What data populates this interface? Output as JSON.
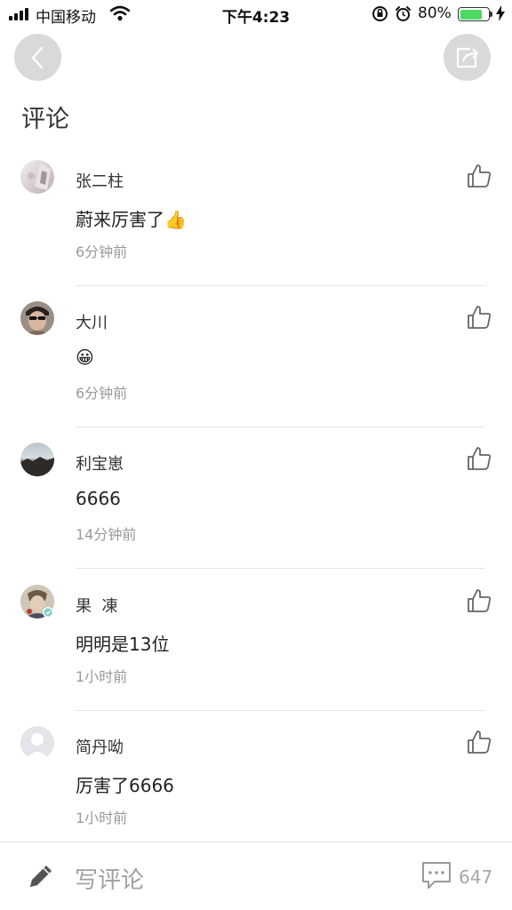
{
  "status_bar": {
    "carrier": "中国移动",
    "time": "下午4:23",
    "battery_percent": "80%",
    "battery_level": 0.8,
    "battery_color": "#4cd964"
  },
  "nav": {
    "back_icon": "chevron-left-icon",
    "share_icon": "share-icon"
  },
  "section_title": "评论",
  "comments": [
    {
      "author": "张二柱",
      "text": "蔚来厉害了",
      "emoji": "👍",
      "time": "6分钟前"
    },
    {
      "author": "大川",
      "text": "",
      "emoji": "😀",
      "time": "6分钟前"
    },
    {
      "author": "利宝崽",
      "text": "6666",
      "emoji": "",
      "time": "14分钟前"
    },
    {
      "author": "果  凍",
      "text": "明明是13位",
      "emoji": "",
      "time": "1小时前"
    },
    {
      "author": "简丹呦",
      "text": "厉害了6666",
      "emoji": "",
      "time": "1小时前"
    }
  ],
  "bottom_bar": {
    "compose_placeholder": "写评论",
    "comment_count": "647"
  }
}
